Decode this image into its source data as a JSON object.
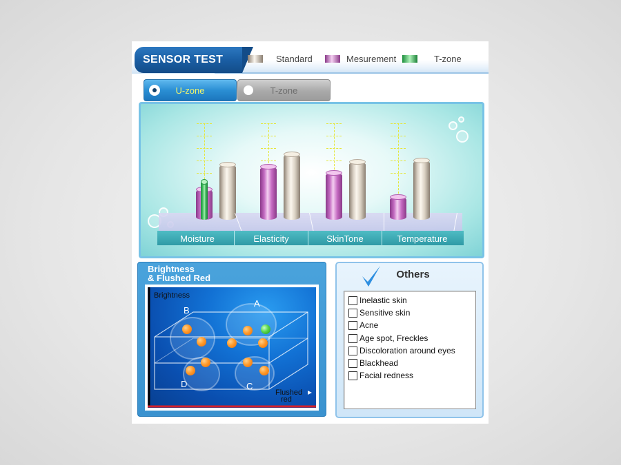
{
  "header": {
    "title": "SENSOR TEST",
    "legend": [
      {
        "label": "Standard",
        "color": "#d8cfc2"
      },
      {
        "label": "Mesurement",
        "color": "#cf78c8"
      },
      {
        "label": "T-zone",
        "color": "#44bb55"
      }
    ]
  },
  "zone_tabs": {
    "u_zone": {
      "label": "U-zone",
      "selected": true
    },
    "t_zone": {
      "label": "T-zone",
      "selected": false
    }
  },
  "sensor_chart": {
    "categories": [
      "Moisture",
      "Elasticity",
      "SkinTone",
      "Temperature"
    ]
  },
  "brightness_panel": {
    "title_line1": "Brightness",
    "title_line2": "& Flushed Red",
    "y_axis": "Brightness",
    "x_axis_line1": "Flushed",
    "x_axis_line2": "red",
    "regions": [
      "A",
      "B",
      "C",
      "D"
    ]
  },
  "others_panel": {
    "title": "Others",
    "items": [
      {
        "label": "Inelastic skin",
        "checked": false
      },
      {
        "label": "Sensitive skin",
        "checked": false
      },
      {
        "label": "Acne",
        "checked": false
      },
      {
        "label": "Age spot, Freckles",
        "checked": false
      },
      {
        "label": "Discoloration around eyes",
        "checked": false
      },
      {
        "label": "Blackhead",
        "checked": false
      },
      {
        "label": "Facial redness",
        "checked": false
      }
    ]
  },
  "chart_data": {
    "type": "bar",
    "categories": [
      "Moisture",
      "Elasticity",
      "SkinTone",
      "Temperature"
    ],
    "series": [
      {
        "name": "Mesurement",
        "values": [
          40,
          70,
          62,
          30
        ]
      },
      {
        "name": "Standard",
        "values": [
          73,
          86,
          76,
          78
        ]
      },
      {
        "name": "T-zone",
        "values": [
          50,
          null,
          null,
          null
        ]
      }
    ],
    "ylim": [
      0,
      100
    ]
  }
}
